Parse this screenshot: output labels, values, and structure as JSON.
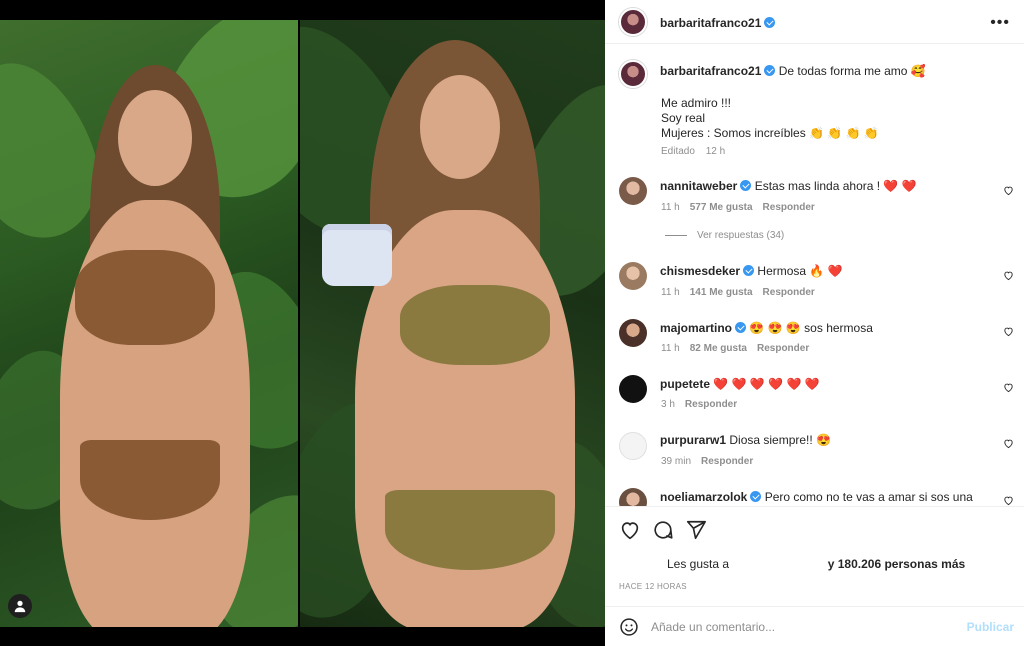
{
  "post": {
    "owner": "barbaritafranco21",
    "verified": true,
    "caption_first_line": "De todas forma me amo 🥰",
    "caption_lines": [
      "Me admiro !!!",
      "Soy real",
      "Mujeres : Somos increíbles 👏 👏 👏 👏"
    ],
    "edited_label": "Editado",
    "edited_time": "12 h"
  },
  "comments": [
    {
      "user": "nannitaweber",
      "verified": true,
      "text": "Estas mas linda ahora ! ❤️ ❤️",
      "time": "11 h",
      "likes": "577 Me gusta",
      "reply": "Responder"
    },
    {
      "user": "chismesdeker",
      "verified": true,
      "text": "Hermosa 🔥 ❤️",
      "time": "11 h",
      "likes": "141 Me gusta",
      "reply": "Responder"
    },
    {
      "user": "majomartino",
      "verified": true,
      "text": "😍 😍 😍 sos hermosa",
      "time": "11 h",
      "likes": "82 Me gusta",
      "reply": "Responder"
    },
    {
      "user": "pupetete",
      "verified": false,
      "text": "❤️ ❤️ ❤️ ❤️ ❤️ ❤️",
      "time": "3 h",
      "likes": "",
      "reply": "Responder"
    },
    {
      "user": "purpurarw1",
      "verified": false,
      "text": "Diosa siempre!! 😍",
      "time": "39 min",
      "likes": "",
      "reply": "Responder"
    },
    {
      "user": "noeliamarzolok",
      "verified": true,
      "text": "Pero como no te vas a amar si sos una",
      "time": "",
      "likes": "",
      "reply": ""
    }
  ],
  "view_replies": "Ver respuestas (34)",
  "likes": {
    "prefix": "Les gusta a",
    "suffix": "y 180.206 personas más"
  },
  "time_ago": "HACE 12 HORAS",
  "add_comment": {
    "placeholder": "Añade un comentario...",
    "post_label": "Publicar"
  },
  "icons": {
    "more": "more-options-icon",
    "like": "heart-icon",
    "comment": "comment-icon",
    "share": "share-icon",
    "emoji": "emoji-icon",
    "user_tag": "user-tag-icon"
  },
  "colors": {
    "verified": "#3897f0",
    "muted": "#8e8e8e",
    "publish_disabled": "#b2dffc"
  }
}
